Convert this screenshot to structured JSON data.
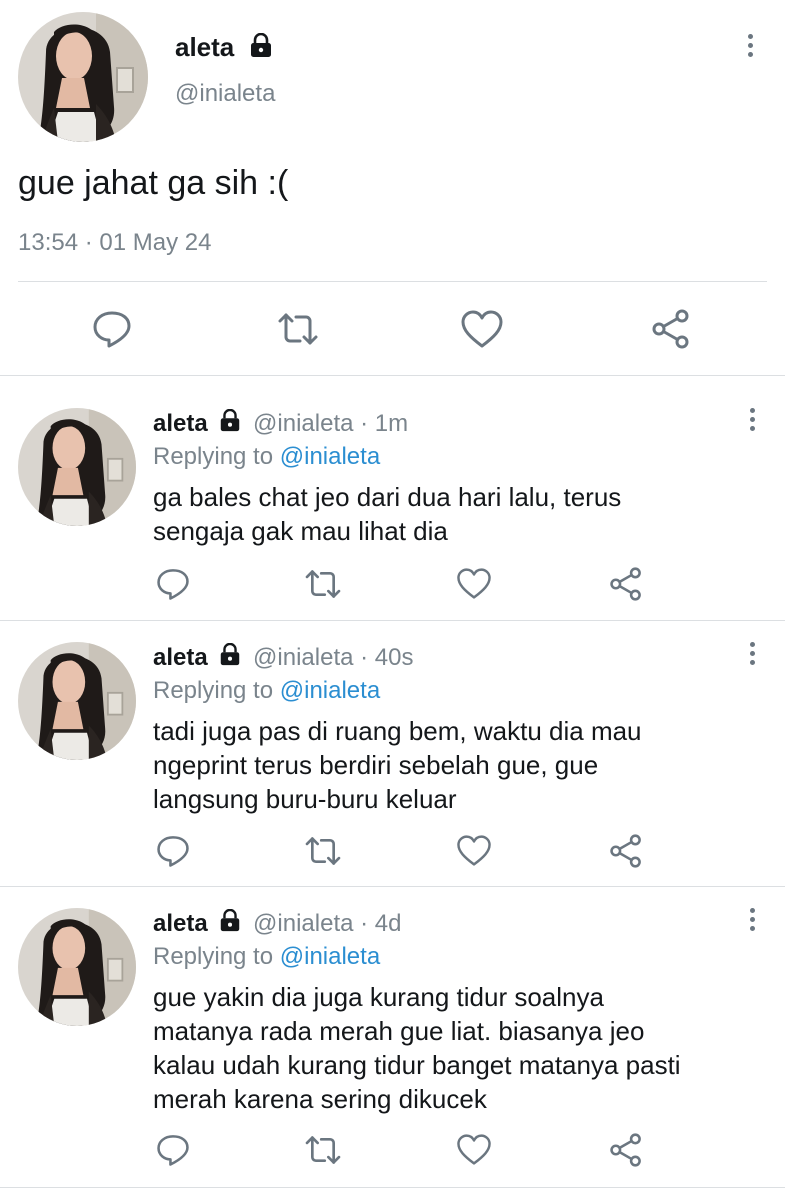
{
  "main_tweet": {
    "display_name": "aleta",
    "handle": "@inialeta",
    "text": "gue jahat ga sih :(",
    "timestamp": "13:54 · 01 May 24"
  },
  "replies": [
    {
      "display_name": "aleta",
      "handle": "@inialeta",
      "time": "· 1m",
      "replying_prefix": "Replying to",
      "replying_to": "@inialeta",
      "lines": [
        "ga bales chat jeo dari dua hari lalu, terus",
        "sengaja gak mau lihat dia"
      ]
    },
    {
      "display_name": "aleta",
      "handle": "@inialeta",
      "time": "· 40s",
      "replying_prefix": "Replying to",
      "replying_to": "@inialeta",
      "lines": [
        "tadi juga pas di ruang bem, waktu dia mau",
        "ngeprint terus berdiri sebelah gue, gue",
        "langsung buru-buru keluar"
      ]
    },
    {
      "display_name": "aleta",
      "handle": "@inialeta",
      "time": "· 4d",
      "replying_prefix": "Replying to",
      "replying_to": "@inialeta",
      "lines": [
        "gue yakin dia juga kurang tidur soalnya",
        "matanya rada merah gue liat. biasanya jeo",
        "kalau udah kurang tidur banget matanya pasti",
        "merah karena sering dikucek"
      ]
    }
  ],
  "icons": {
    "lock": "lock-icon",
    "more": "more-vertical-icon",
    "reply": "comment-icon",
    "retweet": "retweet-icon",
    "like": "heart-icon",
    "share": "share-icon"
  },
  "colors": {
    "icon": "#6b7680",
    "link": "#2b8ed1",
    "muted": "#7a848c",
    "divider": "#dcdfe2"
  }
}
